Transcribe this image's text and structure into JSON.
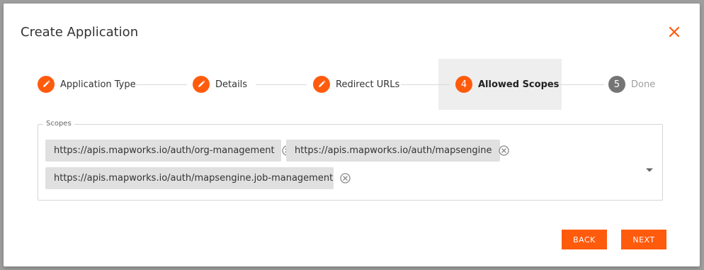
{
  "dialog": {
    "title": "Create Application",
    "close_icon": "close-icon"
  },
  "stepper": {
    "steps": [
      {
        "label": "Application Type",
        "indicator": "pencil-icon",
        "state": "completed"
      },
      {
        "label": "Details",
        "indicator": "pencil-icon",
        "state": "completed"
      },
      {
        "label": "Redirect URLs",
        "indicator": "pencil-icon",
        "state": "completed"
      },
      {
        "label": "Allowed Scopes",
        "indicator": "4",
        "state": "active"
      },
      {
        "label": "Done",
        "indicator": "5",
        "state": "inactive"
      }
    ]
  },
  "scopes": {
    "legend": "Scopes",
    "chips": [
      {
        "label": "https://apis.mapworks.io/auth/org-management"
      },
      {
        "label": "https://apis.mapworks.io/auth/mapsengine"
      },
      {
        "label": "https://apis.mapworks.io/auth/mapsengine.job-management"
      }
    ]
  },
  "actions": {
    "back_label": "BACK",
    "next_label": "NEXT"
  },
  "colors": {
    "accent": "#ff5b0d",
    "inactive_step": "#757575",
    "chip_bg": "#e0e0e0",
    "active_step_bg": "#eeeeee"
  }
}
